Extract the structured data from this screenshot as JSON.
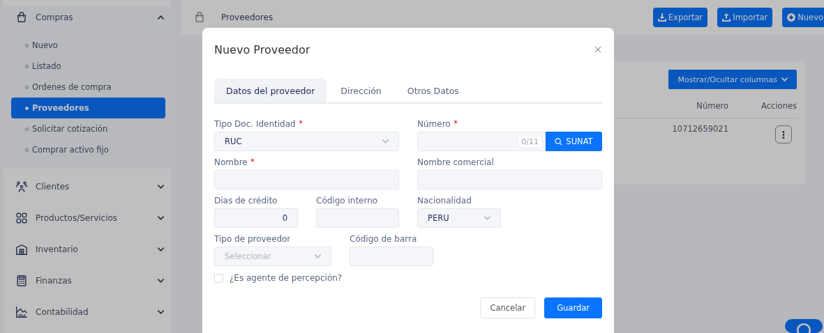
{
  "sidebar": {
    "groups": [
      {
        "label": "Compras",
        "expanded": true,
        "children": [
          {
            "label": "Nuevo",
            "selected": false
          },
          {
            "label": "Listado",
            "selected": false
          },
          {
            "label": "Ordenes de compra",
            "selected": false
          },
          {
            "label": "Proveedores",
            "selected": true
          },
          {
            "label": "Solicitar cotización",
            "selected": false
          },
          {
            "label": "Comprar activo fijo",
            "selected": false
          }
        ]
      },
      {
        "label": "Clientes",
        "expanded": false
      },
      {
        "label": "Productos/Servicios",
        "expanded": false
      },
      {
        "label": "Inventario",
        "expanded": false
      },
      {
        "label": "Finanzas",
        "expanded": false
      },
      {
        "label": "Contabilidad",
        "expanded": false
      }
    ]
  },
  "header": {
    "title": "Proveedores",
    "buttons": [
      "Exportar",
      "Importar",
      "Nuevo"
    ]
  },
  "card": {
    "toggle_button": "Mostrar/Ocultar columnas",
    "columns": [
      "Número",
      "Acciones"
    ],
    "rows": [
      {
        "number": "10712659021"
      }
    ]
  },
  "modal": {
    "title": "Nuevo Proveedor",
    "tabs": [
      {
        "label": "Datos del proveedor",
        "selected": true
      },
      {
        "label": "Dirección",
        "selected": false
      },
      {
        "label": "Otros Datos",
        "selected": false
      }
    ],
    "rows": [
      [
        {
          "label": "Tipo Doc. Identidad",
          "required": true,
          "kind": "select",
          "value": "RUC"
        },
        {
          "label": "Número",
          "required": true,
          "kind": "search",
          "counter": "0/11",
          "button": "SUNAT"
        }
      ],
      [
        {
          "label": "Nombre",
          "required": true,
          "kind": "input"
        },
        {
          "label": "Nombre comercial",
          "required": false,
          "kind": "input"
        }
      ],
      [
        {
          "label": "Dias de crédito",
          "required": false,
          "kind": "number",
          "value": "0"
        },
        {
          "label": "Código interno",
          "required": false,
          "kind": "input"
        },
        {
          "label": "Nacionalidad",
          "required": false,
          "kind": "select",
          "value": "PERU"
        }
      ],
      [
        {
          "label": "Tipo de proveedor",
          "required": false,
          "kind": "select",
          "placeholder": "Seleccionar",
          "disabled": true
        },
        {
          "label": "Código de barra",
          "required": false,
          "kind": "input"
        }
      ]
    ],
    "checkbox": {
      "label": "¿Es agente de percepción?",
      "checked": false
    },
    "buttons": [
      {
        "label": "Cancelar",
        "primary": false
      },
      {
        "label": "Guardar",
        "primary": true
      }
    ]
  }
}
